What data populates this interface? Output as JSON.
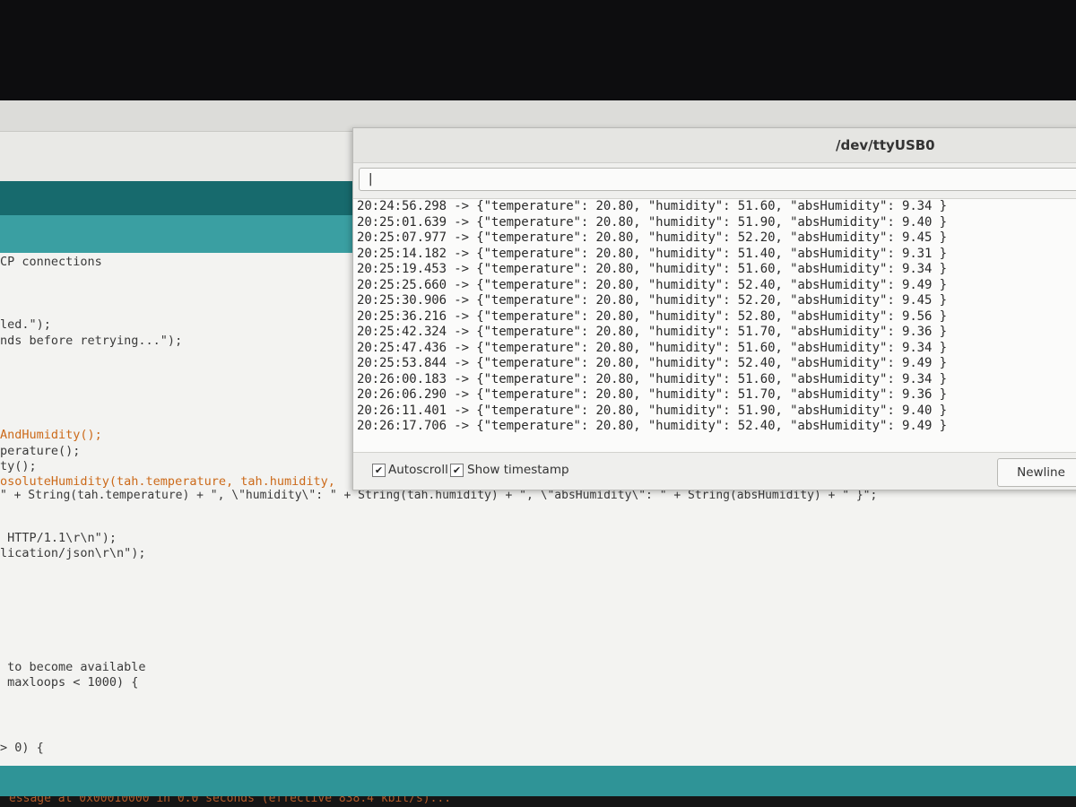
{
  "serial_monitor": {
    "title": "/dev/ttyUSB0",
    "input_value": "|",
    "lines": [
      "20:24:56.298 -> {\"temperature\": 20.80, \"humidity\": 51.60, \"absHumidity\": 9.34 }",
      "20:25:01.639 -> {\"temperature\": 20.80, \"humidity\": 51.90, \"absHumidity\": 9.40 }",
      "20:25:07.977 -> {\"temperature\": 20.80, \"humidity\": 52.20, \"absHumidity\": 9.45 }",
      "20:25:14.182 -> {\"temperature\": 20.80, \"humidity\": 51.40, \"absHumidity\": 9.31 }",
      "20:25:19.453 -> {\"temperature\": 20.80, \"humidity\": 51.60, \"absHumidity\": 9.34 }",
      "20:25:25.660 -> {\"temperature\": 20.80, \"humidity\": 52.40, \"absHumidity\": 9.49 }",
      "20:25:30.906 -> {\"temperature\": 20.80, \"humidity\": 52.20, \"absHumidity\": 9.45 }",
      "20:25:36.216 -> {\"temperature\": 20.80, \"humidity\": 52.80, \"absHumidity\": 9.56 }",
      "20:25:42.324 -> {\"temperature\": 20.80, \"humidity\": 51.70, \"absHumidity\": 9.36 }",
      "20:25:47.436 -> {\"temperature\": 20.80, \"humidity\": 51.60, \"absHumidity\": 9.34 }",
      "20:25:53.844 -> {\"temperature\": 20.80, \"humidity\": 52.40, \"absHumidity\": 9.49 }",
      "20:26:00.183 -> {\"temperature\": 20.80, \"humidity\": 51.60, \"absHumidity\": 9.34 }",
      "20:26:06.290 -> {\"temperature\": 20.80, \"humidity\": 51.70, \"absHumidity\": 9.36 }",
      "20:26:11.401 -> {\"temperature\": 20.80, \"humidity\": 51.90, \"absHumidity\": 9.40 }",
      "20:26:17.706 -> {\"temperature\": 20.80, \"humidity\": 52.40, \"absHumidity\": 9.49 }"
    ],
    "autoscroll_label": "Autoscroll",
    "timestamp_label": "Show timestamp",
    "line_ending": "Newline"
  },
  "editor": {
    "code_lines": [
      "CP connections",
      "led.\");",
      "nds before retrying...\");",
      "AndHumidity();",
      "perature();",
      "ty();",
      "osoluteHumidity(tah.temperature, tah.humidity,",
      "\" + String(tah.temperature) + \", \\\"humidity\\\": \" + String(tah.humidity) + \", \\\"absHumidity\\\": \" + String(absHumidity) + \" }\";",
      " HTTP/1.1\\r\\n\");",
      "lication/json\\r\\n\");",
      " to become available",
      " maxloops < 1000) {",
      "> 0) {"
    ],
    "console_text": "essage at 0x00010000 in 0.0 seconds (effective 838.4 kbit/s)..."
  }
}
